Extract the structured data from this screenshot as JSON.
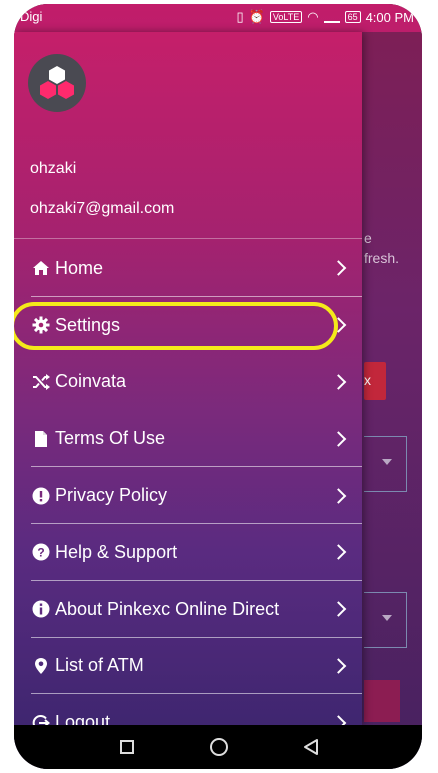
{
  "status_bar": {
    "carrier": "Digi",
    "battery": "65",
    "time": "4:00 PM"
  },
  "background_app": {
    "text_line1": "e",
    "text_line2": "fresh.",
    "red_button_label": "x"
  },
  "drawer": {
    "user_name": "ohzaki",
    "user_email": "ohzaki7@gmail.com",
    "items": [
      {
        "label": "Home",
        "icon": "home-icon"
      },
      {
        "label": "Settings",
        "icon": "gear-icon"
      },
      {
        "label": "Coinvata",
        "icon": "shuffle-icon"
      },
      {
        "label": "Terms Of Use",
        "icon": "document-icon"
      },
      {
        "label": "Privacy Policy",
        "icon": "exclamation-circle-icon"
      },
      {
        "label": "Help & Support",
        "icon": "question-circle-icon"
      },
      {
        "label": "About Pinkexc Online Direct",
        "icon": "info-circle-icon"
      },
      {
        "label": "List of ATM",
        "icon": "map-marker-icon"
      },
      {
        "label": "Logout",
        "icon": "logout-icon"
      }
    ]
  },
  "highlight_color": "#f4ea1a"
}
